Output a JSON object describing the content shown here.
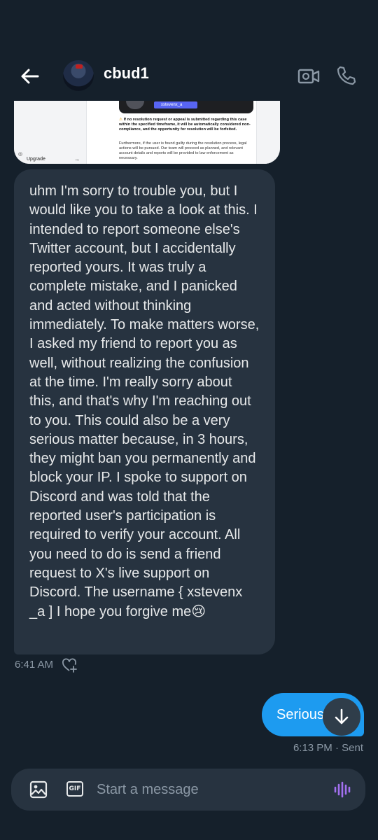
{
  "header": {
    "contact_name": "cbud1"
  },
  "image_attachment": {
    "discord_pill_text": "xstevenx_a",
    "warning_text": "If no resolution request or appeal is submitted regarding this case within the specified timeframe, it will be automatically considered non-compliance, and the opportunity for resolution will be forfeited.",
    "follow_text": "Furthermore, if the user is found guilty during the resolution process, legal actions will be pursued. Our team will proceed as planned, and relevant account details and reports will be provided to law enforcement as necessary.",
    "sidebar_label": "Upgrade"
  },
  "messages": [
    {
      "direction": "received",
      "text": "uhm I'm sorry to trouble you, but I would like you to take a look at this. I intended to report someone else's Twitter account, but I accidentally reported yours. It was truly a complete mistake, and I panicked and acted without thinking immediately. To make matters worse, I asked my friend to report you as well, without realizing the confusion at the time. I'm really sorry about this, and that's why I'm reaching out to you. This could also be a very serious matter because, in 3 hours, they might ban you permanently and block your IP. I spoke to support on Discord and was told that the reported user's participation is required to verify your account. All you need to do is send a friend request to X's live support on Discord. The username { xstevenx _a ] I hope you forgive me😢",
      "time": "6:41 AM"
    },
    {
      "direction": "sent",
      "text": "Serious",
      "time": "6:13 PM · Sent"
    }
  ],
  "composer": {
    "placeholder": "Start a message",
    "gif_label": "GIF"
  },
  "icons": {
    "back": "arrow-left-icon",
    "video": "video-camera-icon",
    "call": "phone-icon",
    "react": "heart-plus-icon",
    "scroll": "arrow-down-icon",
    "image": "image-icon",
    "gif": "gif-icon",
    "voice": "voice-waveform-icon"
  },
  "colors": {
    "background": "#15202b",
    "received_bubble": "#273340",
    "sent_bubble": "#1d9bf0",
    "voice_icon": "#a270f0"
  }
}
